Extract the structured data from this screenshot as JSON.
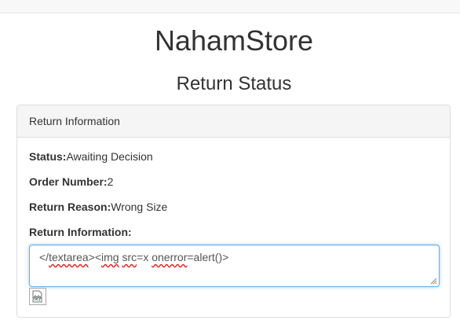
{
  "store": {
    "name": "NahamStore"
  },
  "page": {
    "title": "Return Status"
  },
  "panel": {
    "heading": "Return Information",
    "status_label": "Status:",
    "status_value": "Awaiting Decision",
    "order_label": "Order Number:",
    "order_value": "2",
    "reason_label": "Return Reason:",
    "reason_value": "Wrong Size",
    "info_label": "Return Information:",
    "info_text_parts": [
      "</",
      "textarea",
      "><",
      "img",
      " ",
      "src",
      "=x ",
      "onerror",
      "=alert()>"
    ]
  },
  "icons": {
    "broken_image": "broken-image-icon",
    "resize_grip": "resize-grip-icon"
  },
  "colors": {
    "focus_border": "#66afe9",
    "panel_heading_bg": "#f5f5f5",
    "spellcheck": "#e02020"
  }
}
